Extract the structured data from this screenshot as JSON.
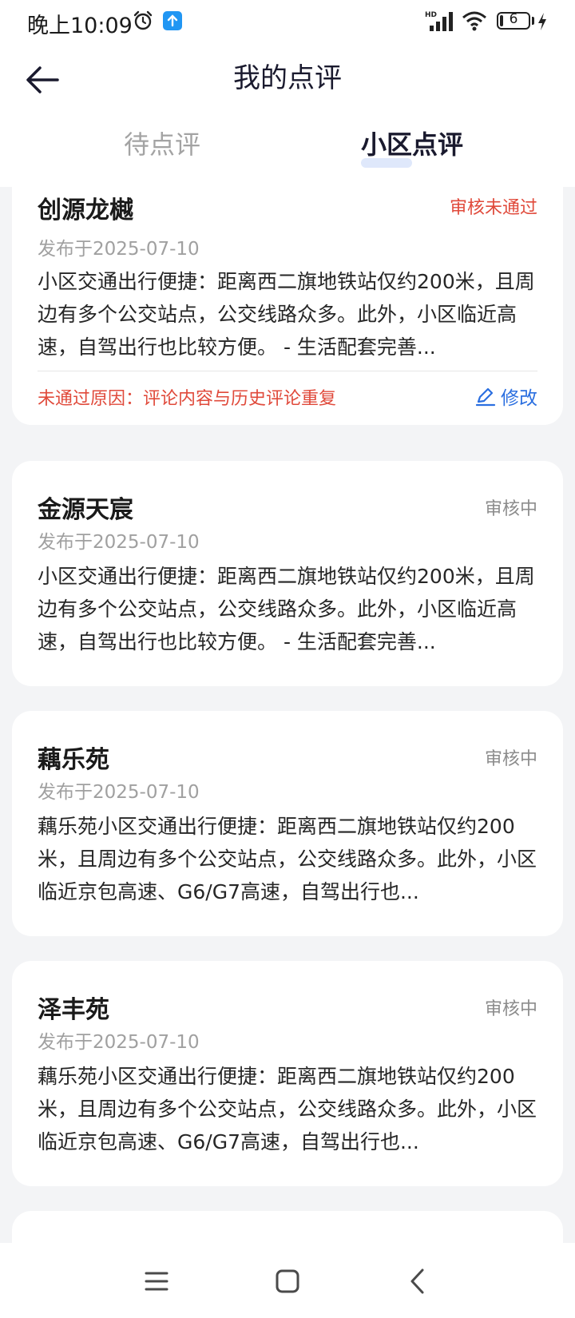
{
  "status_bar": {
    "time": "晚上10:09",
    "battery": "6",
    "icons": [
      "alarm-icon",
      "notification-icon",
      "hd-signal-icon",
      "wifi-icon",
      "battery-icon",
      "charging-icon"
    ]
  },
  "header": {
    "title": "我的点评",
    "back_icon": "arrow-left-icon"
  },
  "tabs": [
    {
      "label": "待点评",
      "active": false
    },
    {
      "label": "小区点评",
      "active": true
    }
  ],
  "colors": {
    "accent": "#2b6fe0",
    "fail": "#e04a3b",
    "muted": "#a0a0a0",
    "background": "#f3f4f6"
  },
  "reviews": [
    {
      "name": "创源龙樾",
      "status": "审核未通过",
      "status_type": "rejected",
      "date": "发布于2025-07-10",
      "content": "小区交通出行便捷：距离西二旗地铁站仅约200米，且周边有多个公交站点，公交线路众多。此外，小区临近高速，自驾出行也比较方便。 - 生活配套完善...",
      "reject_reason": "未通过原因：评论内容与历史评论重复",
      "edit_label": "修改"
    },
    {
      "name": "金源天宸",
      "status": "审核中",
      "status_type": "pending",
      "date": "发布于2025-07-10",
      "content": "小区交通出行便捷：距离西二旗地铁站仅约200米，且周边有多个公交站点，公交线路众多。此外，小区临近高速，自驾出行也比较方便。 - 生活配套完善..."
    },
    {
      "name": "藕乐苑",
      "status": "审核中",
      "status_type": "pending",
      "date": "发布于2025-07-10",
      "content": "藕乐苑小区交通出行便捷：距离西二旗地铁站仅约200米，且周边有多个公交站点，公交线路众多。此外，小区临近京包高速、G6/G7高速，自驾出行也..."
    },
    {
      "name": "泽丰苑",
      "status": "审核中",
      "status_type": "pending",
      "date": "发布于2025-07-10",
      "content": "藕乐苑小区交通出行便捷：距离西二旗地铁站仅约200米，且周边有多个公交站点，公交线路众多。此外，小区临近京包高速、G6/G7高速，自驾出行也..."
    }
  ],
  "nav_bar": {
    "icons": [
      "menu-icon",
      "home-icon",
      "back-icon"
    ]
  }
}
